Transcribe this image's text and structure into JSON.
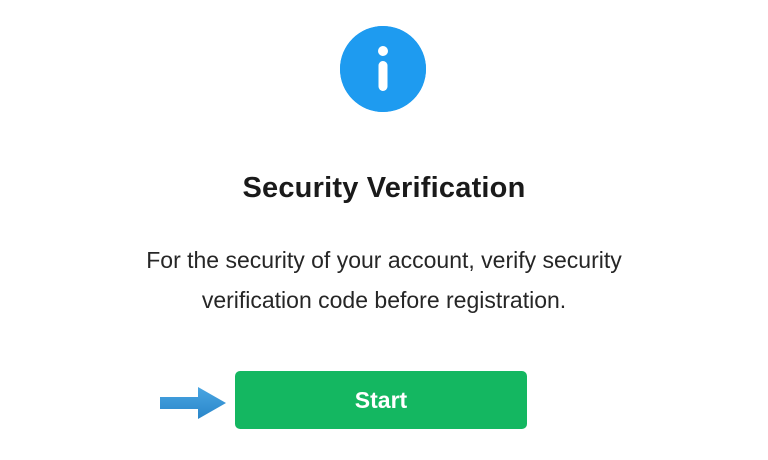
{
  "dialog": {
    "icon": "info-icon",
    "title": "Security Verification",
    "message": "For the security of your account, verify security verification code before registration.",
    "start_label": "Start",
    "pointer": "arrow-right-icon"
  },
  "colors": {
    "info_icon_bg": "#1e9bf0",
    "start_button_bg": "#14b761",
    "arrow": "#2e8fd1"
  }
}
